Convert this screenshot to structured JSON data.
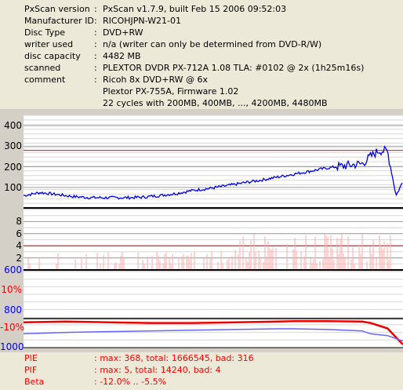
{
  "info": [
    {
      "label": "PxScan version",
      "value": "PxScan v1.7.9, built Feb 15 2006 09:52:03"
    },
    {
      "label": "Manufacturer ID",
      "value": "RICOHJPN-W21-01"
    },
    {
      "label": "Disc Type",
      "value": "DVD+RW"
    },
    {
      "label": "writer used",
      "value": "n/a (writer can only be determined from DVD-R/W)"
    },
    {
      "label": "disc capacity",
      "value": "4482 MB"
    },
    {
      "label": "scanned",
      "value": "PLEXTOR DVDR PX-712A 1.08 TLA: #0102 @ 2x (1h25m16s)"
    },
    {
      "label": "comment",
      "value": "Ricoh 8x DVD+RW @ 6x"
    },
    {
      "label": "",
      "value": "Plextor PX-755A, Firmware 1.02"
    },
    {
      "label": "",
      "value": "22 cycles with 200MB, 400MB, ..., 4200MB, 4480MB"
    }
  ],
  "separator": ":",
  "colors": {
    "pie_line": "#0000ee",
    "pif_bars": "#ffaaaa",
    "threshold": "#ff0000",
    "beta_red": "#ee0000",
    "beta_blue": "#6666ff",
    "tick_blue": "#0000ff",
    "tick_red": "#ff0000"
  },
  "yticks": {
    "pie": [
      "400",
      "300",
      "200",
      "100"
    ],
    "pif": [
      "8",
      "6",
      "4",
      "2"
    ],
    "beta": [
      {
        "text": "600",
        "color": "blue"
      },
      {
        "text": "10%",
        "color": "red"
      },
      {
        "text": "800",
        "color": "blue"
      },
      {
        "text": "-10%",
        "color": "red"
      },
      {
        "text": "1000",
        "color": "blue"
      }
    ]
  },
  "legend": [
    {
      "name": "PIE",
      "value": ": max: 368, total: 1666545, bad: 316"
    },
    {
      "name": "PIF",
      "value": ": max: 5, total: 14240, bad: 4"
    },
    {
      "name": "Beta",
      "value": ": -12.0% .. -5.5%"
    }
  ],
  "chart_data": [
    {
      "type": "line",
      "x_unit": "MB",
      "x": [
        0,
        200,
        400,
        600,
        800,
        1000,
        1200,
        1400,
        1600,
        1800,
        2000,
        2200,
        2400,
        2600,
        2800,
        3000,
        3200,
        3400,
        3600,
        3800,
        4000,
        4100,
        4200,
        4300,
        4400,
        4482
      ],
      "series": [
        {
          "name": "PIE",
          "values": [
            60,
            75,
            65,
            55,
            50,
            50,
            50,
            52,
            60,
            70,
            85,
            95,
            108,
            122,
            135,
            150,
            165,
            180,
            195,
            205,
            215,
            250,
            280,
            275,
            60,
            130
          ]
        }
      ],
      "yticks": [
        100,
        200,
        300,
        400
      ],
      "threshold": 280,
      "ylim": [
        0,
        450
      ]
    },
    {
      "type": "bar",
      "x_unit": "MB",
      "series": [
        {
          "name": "PIF",
          "max": 5
        }
      ],
      "yticks": [
        2,
        4,
        6,
        8
      ],
      "threshold": 4,
      "ylim": [
        0,
        10
      ]
    },
    {
      "type": "line",
      "x_unit": "MB",
      "x": [
        0,
        500,
        1000,
        1500,
        2000,
        2500,
        3000,
        3200,
        3600,
        4000,
        4100,
        4300,
        4482
      ],
      "series": [
        {
          "name": "Beta",
          "values": [
            -5.8,
            -5.6,
            -5.8,
            -6.0,
            -6.0,
            -5.8,
            -5.6,
            -5.5,
            -5.5,
            -5.6,
            -6.0,
            -7.5,
            -12.0
          ]
        },
        {
          "values": [
            -9.0,
            -8.6,
            -8.4,
            -8.2,
            -8.0,
            -7.8,
            -7.6,
            -7.6,
            -7.8,
            -8.2,
            -9.0,
            -9.5,
            -11.0
          ]
        }
      ],
      "yticks": [
        "10%",
        "-10%"
      ]
    }
  ]
}
